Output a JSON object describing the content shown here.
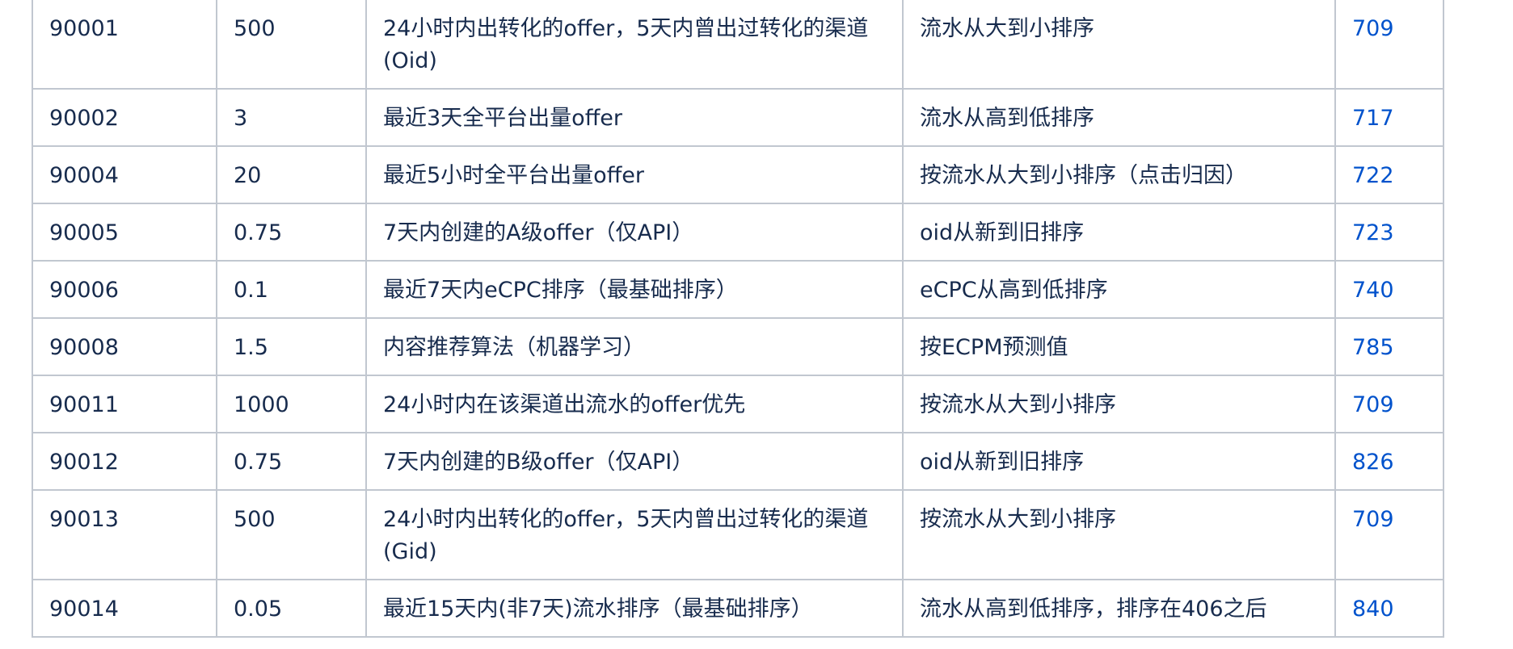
{
  "table": {
    "rows": [
      {
        "id": "90001",
        "weight": "500",
        "description": "24小时内出转化的offer，5天内曾出过转化的渠道(Oid)",
        "sort": "流水从大到小排序",
        "link": "709"
      },
      {
        "id": "90002",
        "weight": "3",
        "description": "最近3天全平台出量offer",
        "sort": "流水从高到低排序",
        "link": "717"
      },
      {
        "id": "90004",
        "weight": "20",
        "description": "最近5小时全平台出量offer",
        "sort": "按流水从大到小排序（点击归因）",
        "link": "722"
      },
      {
        "id": "90005",
        "weight": "0.75",
        "description": "7天内创建的A级offer（仅API）",
        "sort": "oid从新到旧排序",
        "link": "723"
      },
      {
        "id": "90006",
        "weight": "0.1",
        "description": "最近7天内eCPC排序（最基础排序）",
        "sort": "eCPC从高到低排序",
        "link": "740"
      },
      {
        "id": "90008",
        "weight": "1.5",
        "description": "内容推荐算法（机器学习）",
        "sort": "按ECPM预测值",
        "link": "785"
      },
      {
        "id": "90011",
        "weight": "1000",
        "description": "24小时内在该渠道出流水的offer优先",
        "sort": "按流水从大到小排序",
        "link": "709"
      },
      {
        "id": "90012",
        "weight": "0.75",
        "description": "7天内创建的B级offer（仅API）",
        "sort": "oid从新到旧排序",
        "link": "826"
      },
      {
        "id": "90013",
        "weight": "500",
        "description": "24小时内出转化的offer，5天内曾出过转化的渠道(Gid)",
        "sort": "按流水从大到小排序",
        "link": "709"
      },
      {
        "id": "90014",
        "weight": "0.05",
        "description": "最近15天内(非7天)流水排序（最基础排序）",
        "sort": "流水从高到低排序，排序在406之后",
        "link": "840"
      }
    ]
  },
  "colors": {
    "text": "#172b4d",
    "link": "#0052cc",
    "border": "#c1c7d0"
  }
}
